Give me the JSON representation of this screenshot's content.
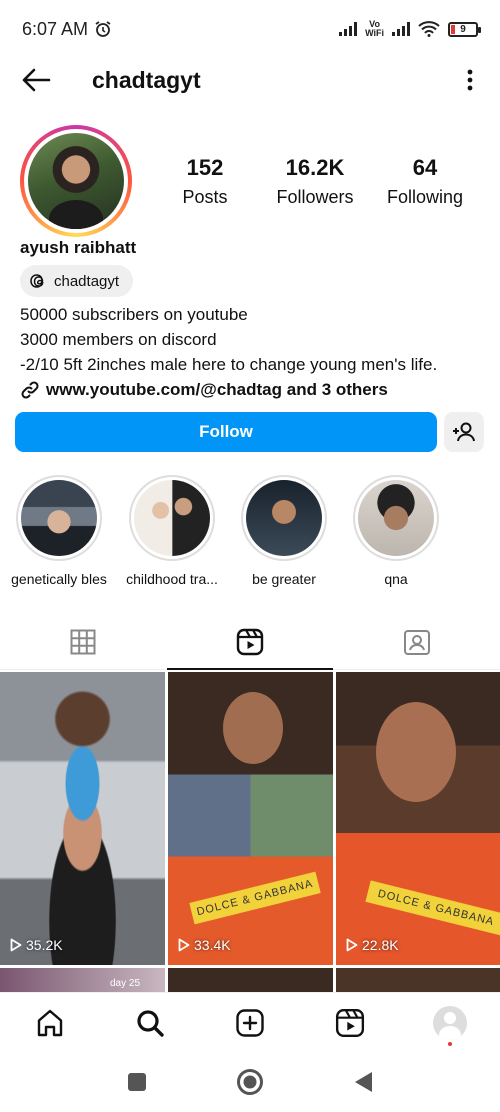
{
  "status_bar": {
    "time": "6:07 AM",
    "network_label_top": "Vo",
    "network_label_bottom": "WiFi",
    "battery_level": "9"
  },
  "header": {
    "username": "chadtagyt"
  },
  "profile": {
    "stats": [
      {
        "value": "152",
        "label": "Posts"
      },
      {
        "value": "16.2K",
        "label": "Followers"
      },
      {
        "value": "64",
        "label": "Following"
      }
    ],
    "full_name": "ayush raibhatt",
    "threads_handle": "chadtagyt",
    "bio_lines": [
      "50000 subscribers on youtube",
      "3000 members on discord",
      "-2/10 5ft 2inches male here to change young men's life."
    ],
    "link_text": "www.youtube.com/@chadtag and 3 others"
  },
  "actions": {
    "follow_label": "Follow"
  },
  "highlights": [
    {
      "label": "genetically bles"
    },
    {
      "label": "childhood tra..."
    },
    {
      "label": "be greater"
    },
    {
      "label": "qna"
    }
  ],
  "tabs": [
    {
      "icon": "grid-icon"
    },
    {
      "icon": "reels-icon"
    },
    {
      "icon": "tagged-icon"
    }
  ],
  "reels": [
    {
      "views": "35.2K"
    },
    {
      "views": "33.4K"
    },
    {
      "views": "22.8K"
    }
  ],
  "reel_overlay_text": "DOLCE & GABBANA",
  "partial_row_caption": "day 25",
  "colors": {
    "follow_button": "#0095f6",
    "notification_dot": "#e53935"
  }
}
